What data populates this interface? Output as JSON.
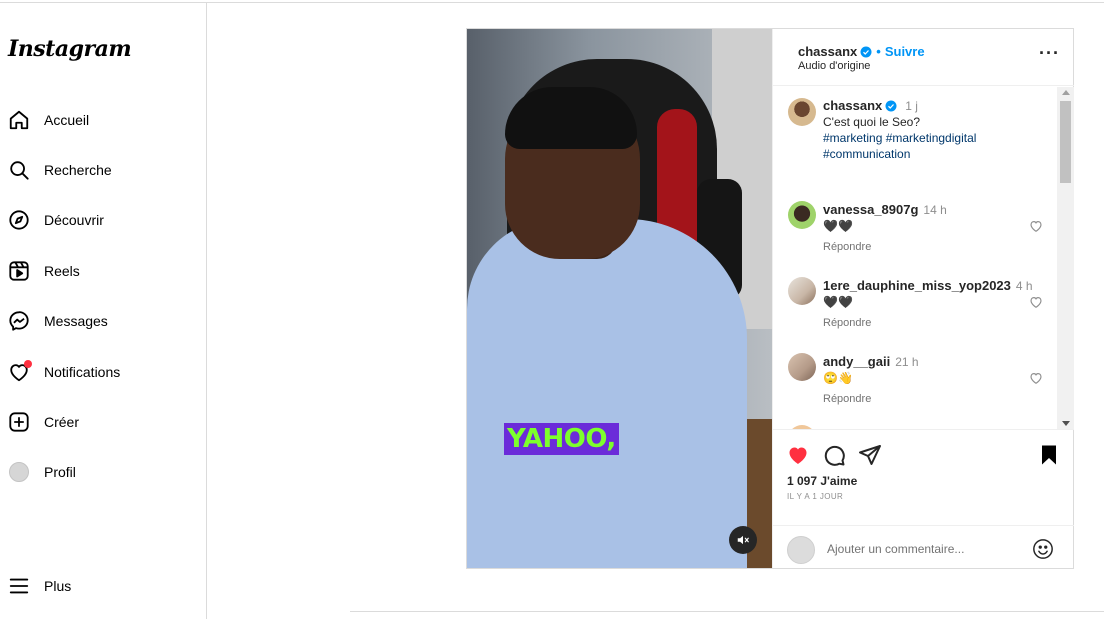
{
  "app": {
    "logo": "Instagram"
  },
  "nav": [
    {
      "label": "Accueil",
      "icon": "home-icon"
    },
    {
      "label": "Recherche",
      "icon": "search-icon"
    },
    {
      "label": "Découvrir",
      "icon": "compass-icon"
    },
    {
      "label": "Reels",
      "icon": "reels-icon"
    },
    {
      "label": "Messages",
      "icon": "messenger-icon"
    },
    {
      "label": "Notifications",
      "icon": "heart-icon"
    },
    {
      "label": "Créer",
      "icon": "plus-square-icon"
    },
    {
      "label": "Profil",
      "icon": "avatar"
    },
    {
      "label": "Plus",
      "icon": "menu-icon"
    }
  ],
  "post": {
    "author": "chassanx",
    "follow_label": "Suivre",
    "audio": "Audio d'origine",
    "video_caption_word": "YAHOO,",
    "caption": {
      "author": "chassanx",
      "time": "1 j",
      "text": "C'est quoi le Seo?",
      "hashtags_line1": "#marketing #marketingdigital",
      "hashtags_line2": "#communication"
    },
    "comments": [
      {
        "user": "vanessa_8907g",
        "time": "14 h",
        "text": "🖤🖤",
        "reply": "Répondre"
      },
      {
        "user": "1ere_dauphine_miss_yop2023",
        "time": "4 h",
        "text": "🖤🖤",
        "reply": "Répondre"
      },
      {
        "user": "andy__gaii",
        "time": "21 h",
        "text": "🙄👋",
        "reply": "Répondre"
      }
    ],
    "likes": "1 097 J'aime",
    "date": "IL Y A 1 JOUR",
    "comment_placeholder": "Ajouter un commentaire..."
  },
  "colors": {
    "accent": "#0095f6",
    "like": "#ff3040",
    "caption_bg": "#6b2bd9",
    "caption_fg": "#7dff2c"
  }
}
